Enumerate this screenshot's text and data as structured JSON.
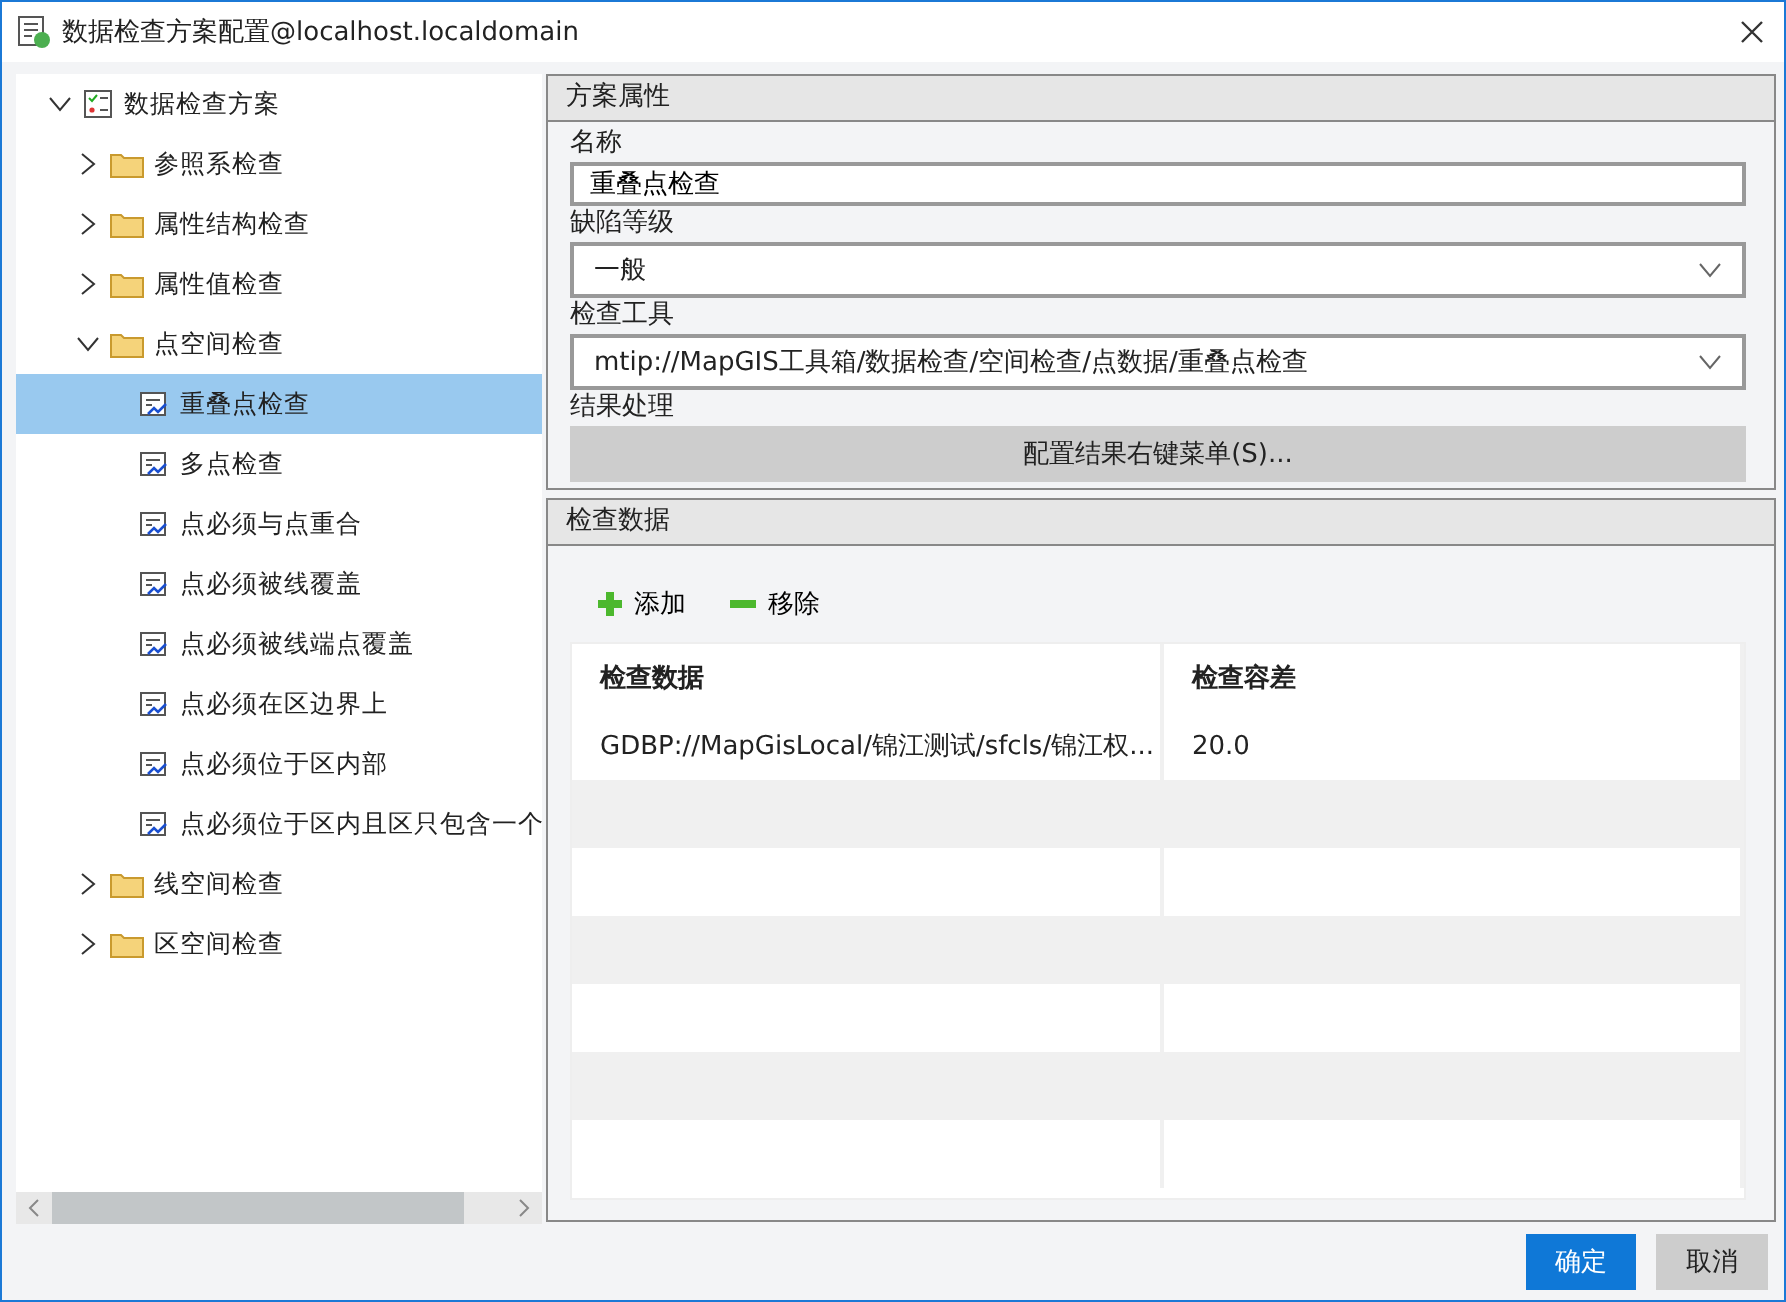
{
  "window": {
    "title": "数据检查方案配置@localhost.localdomain"
  },
  "tree": {
    "label": "数据检查方案",
    "kind": "root",
    "expanded": true,
    "selected": false,
    "children": [
      {
        "label": "参照系检查",
        "kind": "folder",
        "expanded": false,
        "selected": false
      },
      {
        "label": "属性结构检查",
        "kind": "folder",
        "expanded": false,
        "selected": false
      },
      {
        "label": "属性值检查",
        "kind": "folder",
        "expanded": false,
        "selected": false
      },
      {
        "label": "点空间检查",
        "kind": "folder",
        "expanded": true,
        "selected": false,
        "children": [
          {
            "label": "重叠点检查",
            "kind": "rule",
            "selected": true
          },
          {
            "label": "多点检查",
            "kind": "rule",
            "selected": false
          },
          {
            "label": "点必须与点重合",
            "kind": "rule",
            "selected": false
          },
          {
            "label": "点必须被线覆盖",
            "kind": "rule",
            "selected": false
          },
          {
            "label": "点必须被线端点覆盖",
            "kind": "rule",
            "selected": false
          },
          {
            "label": "点必须在区边界上",
            "kind": "rule",
            "selected": false
          },
          {
            "label": "点必须位于区内部",
            "kind": "rule",
            "selected": false
          },
          {
            "label": "点必须位于区内且区只包含一个",
            "kind": "rule",
            "selected": false
          }
        ]
      },
      {
        "label": "线空间检查",
        "kind": "folder",
        "expanded": false,
        "selected": false
      },
      {
        "label": "区空间检查",
        "kind": "folder",
        "expanded": false,
        "selected": false
      }
    ]
  },
  "properties": {
    "title": "方案属性",
    "name_label": "名称",
    "name_value": "重叠点检查",
    "level_label": "缺陷等级",
    "level_value": "一般",
    "tool_label": "检查工具",
    "tool_value": "mtip://MapGIS工具箱/数据检查/空间检查/点数据/重叠点检查",
    "result_label": "结果处理",
    "result_button": "配置结果右键菜单(S)..."
  },
  "check_data": {
    "title": "检查数据",
    "add": "添加",
    "remove": "移除",
    "table": {
      "columns": [
        "检查数据",
        "检查容差"
      ],
      "rows": [
        [
          "GDBP://MapGisLocal/锦江测试/sfcls/锦江权...",
          "20.0"
        ]
      ]
    }
  },
  "buttons": {
    "ok": "确定",
    "cancel": "取消"
  }
}
